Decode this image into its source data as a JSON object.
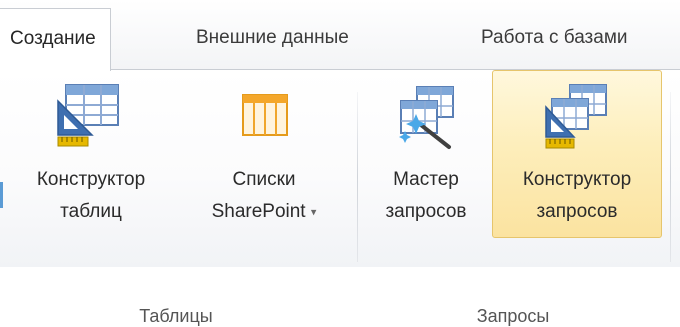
{
  "tabs": [
    {
      "label": "Создание",
      "active": true
    },
    {
      "label": "Внешние данные",
      "active": false
    },
    {
      "label": "Работа с базами",
      "active": false
    }
  ],
  "groups": {
    "tables": {
      "label": "Таблицы",
      "buttons": {
        "table_designer": {
          "line1": "Конструктор",
          "line2": "таблиц",
          "icon": "table-designer-icon"
        },
        "sharepoint_lists": {
          "line1": "Списки",
          "line2": "SharePoint",
          "dropdown": "▾",
          "icon": "sharepoint-list-icon"
        }
      }
    },
    "queries": {
      "label": "Запросы",
      "buttons": {
        "query_wizard": {
          "line1": "Мастер",
          "line2": "запросов",
          "icon": "query-wizard-icon"
        },
        "query_designer": {
          "line1": "Конструктор",
          "line2": "запросов",
          "icon": "query-designer-icon",
          "highlighted": true
        }
      }
    }
  },
  "colors": {
    "hover_fill": "#fdeebb",
    "hover_border": "#e6c56c",
    "table_blue": "#4f81bd",
    "list_orange": "#f7a934"
  }
}
